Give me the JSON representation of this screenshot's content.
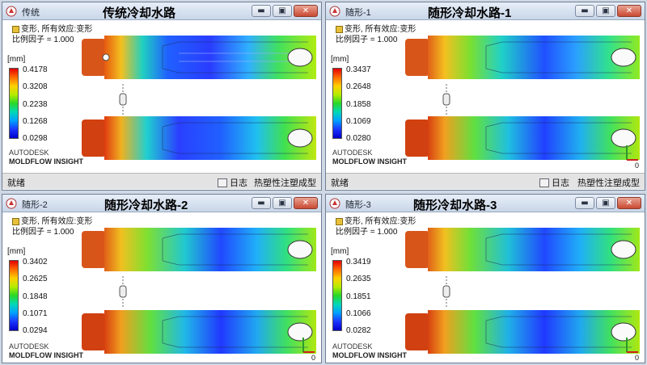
{
  "windows": [
    {
      "id": "w1",
      "title": "传统",
      "big_title": "传统冷却水路",
      "header": {
        "line1": "变形, 所有效应:变形",
        "line2": "比例因子 = 1.000"
      },
      "legend": {
        "unit": "[mm]",
        "values": [
          "0.4178",
          "0.3208",
          "0.2238",
          "0.1268",
          "0.0298"
        ]
      },
      "brand": {
        "line1": "AUTODESK",
        "line2": "MOLDFLOW INSIGHT"
      },
      "status": {
        "ready": "就绪",
        "log": "日志",
        "mode": "热塑性注塑成型"
      }
    },
    {
      "id": "w2",
      "title": "随形-1",
      "big_title": "随形冷却水路-1",
      "header": {
        "line1": "变形, 所有效应:变形",
        "line2": "比例因子 = 1.000"
      },
      "legend": {
        "unit": "[mm]",
        "values": [
          "0.3437",
          "0.2648",
          "0.1858",
          "0.1069",
          "0.0280"
        ]
      },
      "brand": {
        "line1": "AUTODESK",
        "line2": "MOLDFLOW INSIGHT"
      },
      "axis_zero": "0",
      "status": {
        "ready": "就绪",
        "log": "日志",
        "mode": "热塑性注塑成型"
      }
    },
    {
      "id": "w3",
      "title": "随形-2",
      "big_title": "随形冷却水路-2",
      "header": {
        "line1": "变形, 所有效应:变形",
        "line2": "比例因子 = 1.000"
      },
      "legend": {
        "unit": "[mm]",
        "values": [
          "0.3402",
          "0.2625",
          "0.1848",
          "0.1071",
          "0.0294"
        ]
      },
      "brand": {
        "line1": "AUTODESK",
        "line2": "MOLDFLOW INSIGHT"
      },
      "axis_zero": "0"
    },
    {
      "id": "w4",
      "title": "随形-3",
      "big_title": "随形冷却水路-3",
      "header": {
        "line1": "变形, 所有效应:变形",
        "line2": "比例因子 = 1.000"
      },
      "legend": {
        "unit": "[mm]",
        "values": [
          "0.3419",
          "0.2635",
          "0.1851",
          "0.1066",
          "0.0282"
        ]
      },
      "brand": {
        "line1": "AUTODESK",
        "line2": "MOLDFLOW INSIGHT"
      },
      "axis_zero": "0"
    }
  ],
  "window_controls": {
    "minimize": "▬",
    "maximize": "▣",
    "close": "✕"
  },
  "icons": {
    "app": "moldflow-app-icon",
    "log": "log-icon"
  },
  "colors": {
    "deflection_max": "#e40000",
    "deflection_min": "#0000c8",
    "titlebar": "#d4deec",
    "status_bar": "#e3e3e3"
  }
}
